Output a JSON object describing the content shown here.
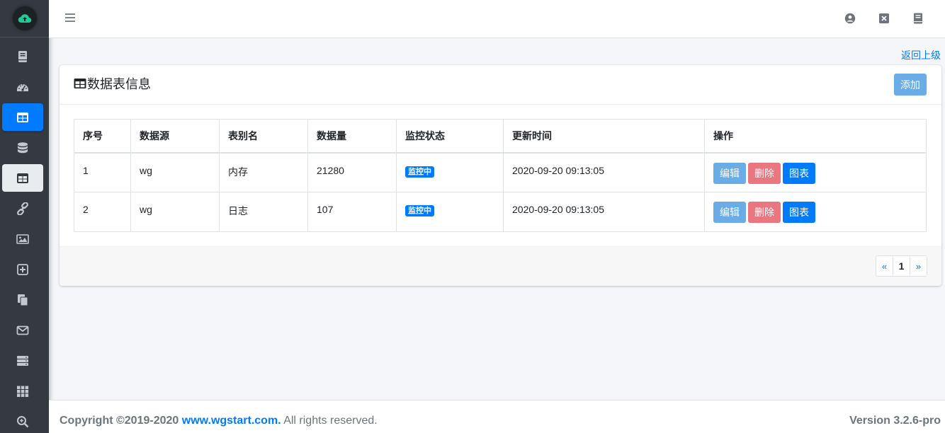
{
  "sidebar": {
    "items": [
      {
        "icon": "book-icon"
      },
      {
        "icon": "dashboard-icon"
      },
      {
        "icon": "table-icon",
        "state": "active"
      },
      {
        "icon": "database-icon"
      },
      {
        "icon": "table-icon",
        "state": "hover"
      },
      {
        "icon": "link-icon"
      },
      {
        "icon": "image-icon"
      },
      {
        "icon": "plus-square-icon"
      },
      {
        "icon": "copy-icon"
      },
      {
        "icon": "envelope-icon"
      },
      {
        "icon": "server-icon"
      },
      {
        "icon": "grid-icon"
      },
      {
        "icon": "search-plus-icon"
      }
    ]
  },
  "topbar": {
    "icons": [
      "user-circle-icon",
      "close-square-icon",
      "book-icon"
    ]
  },
  "back_link": "返回上级",
  "card": {
    "title": "数据表信息",
    "add_label": "添加",
    "columns": [
      "序号",
      "数据源",
      "表别名",
      "数据量",
      "监控状态",
      "更新时间",
      "操作"
    ],
    "rows": [
      {
        "no": "1",
        "source": "wg",
        "alias": "内存",
        "count": "21280",
        "status": "监控中",
        "updated": "2020-09-20 09:13:05"
      },
      {
        "no": "2",
        "source": "wg",
        "alias": "日志",
        "count": "107",
        "status": "监控中",
        "updated": "2020-09-20 09:13:05"
      }
    ],
    "actions": {
      "edit": "编辑",
      "delete": "删除",
      "chart": "图表"
    },
    "pagination": {
      "prev": "«",
      "current": "1",
      "next": "»"
    }
  },
  "footer": {
    "copyright_prefix": "Copyright ©2019-2020 ",
    "site": "www.wgstart.com.",
    "rights": " All rights reserved.",
    "version": "Version 3.2.6-pro"
  },
  "colors": {
    "sidebar_bg": "#343a40",
    "primary": "#007bff",
    "edit_btn": "#6aace6",
    "delete_btn": "#ea7680"
  }
}
